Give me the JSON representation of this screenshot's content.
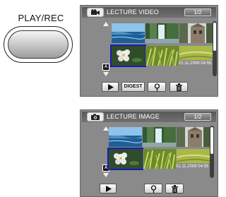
{
  "physical_button": {
    "label": "PLAY/REC"
  },
  "video_screen": {
    "mode_icon": "video-camera-icon",
    "title": "LECTURE VIDEO",
    "page": "1/2",
    "date": "01.11.2009 04:55",
    "lock_mark": "A",
    "buttons": {
      "play_icon": "play-icon",
      "digest_label": "DIGEST",
      "search_icon": "search-icon",
      "delete_icon": "trash-icon"
    }
  },
  "image_screen": {
    "mode_icon": "camera-icon",
    "title": "LECTURE IMAGE",
    "page": "1/2",
    "date": "01.11.2009 04:55",
    "lock_mark": "A",
    "buttons": {
      "play_icon": "play-icon",
      "search_icon": "search-icon",
      "delete_icon": "trash-icon"
    }
  },
  "colors": {
    "screen_bg": "#8a8a8a",
    "header_bg": "#606060",
    "selection": "#1a1ab8"
  }
}
